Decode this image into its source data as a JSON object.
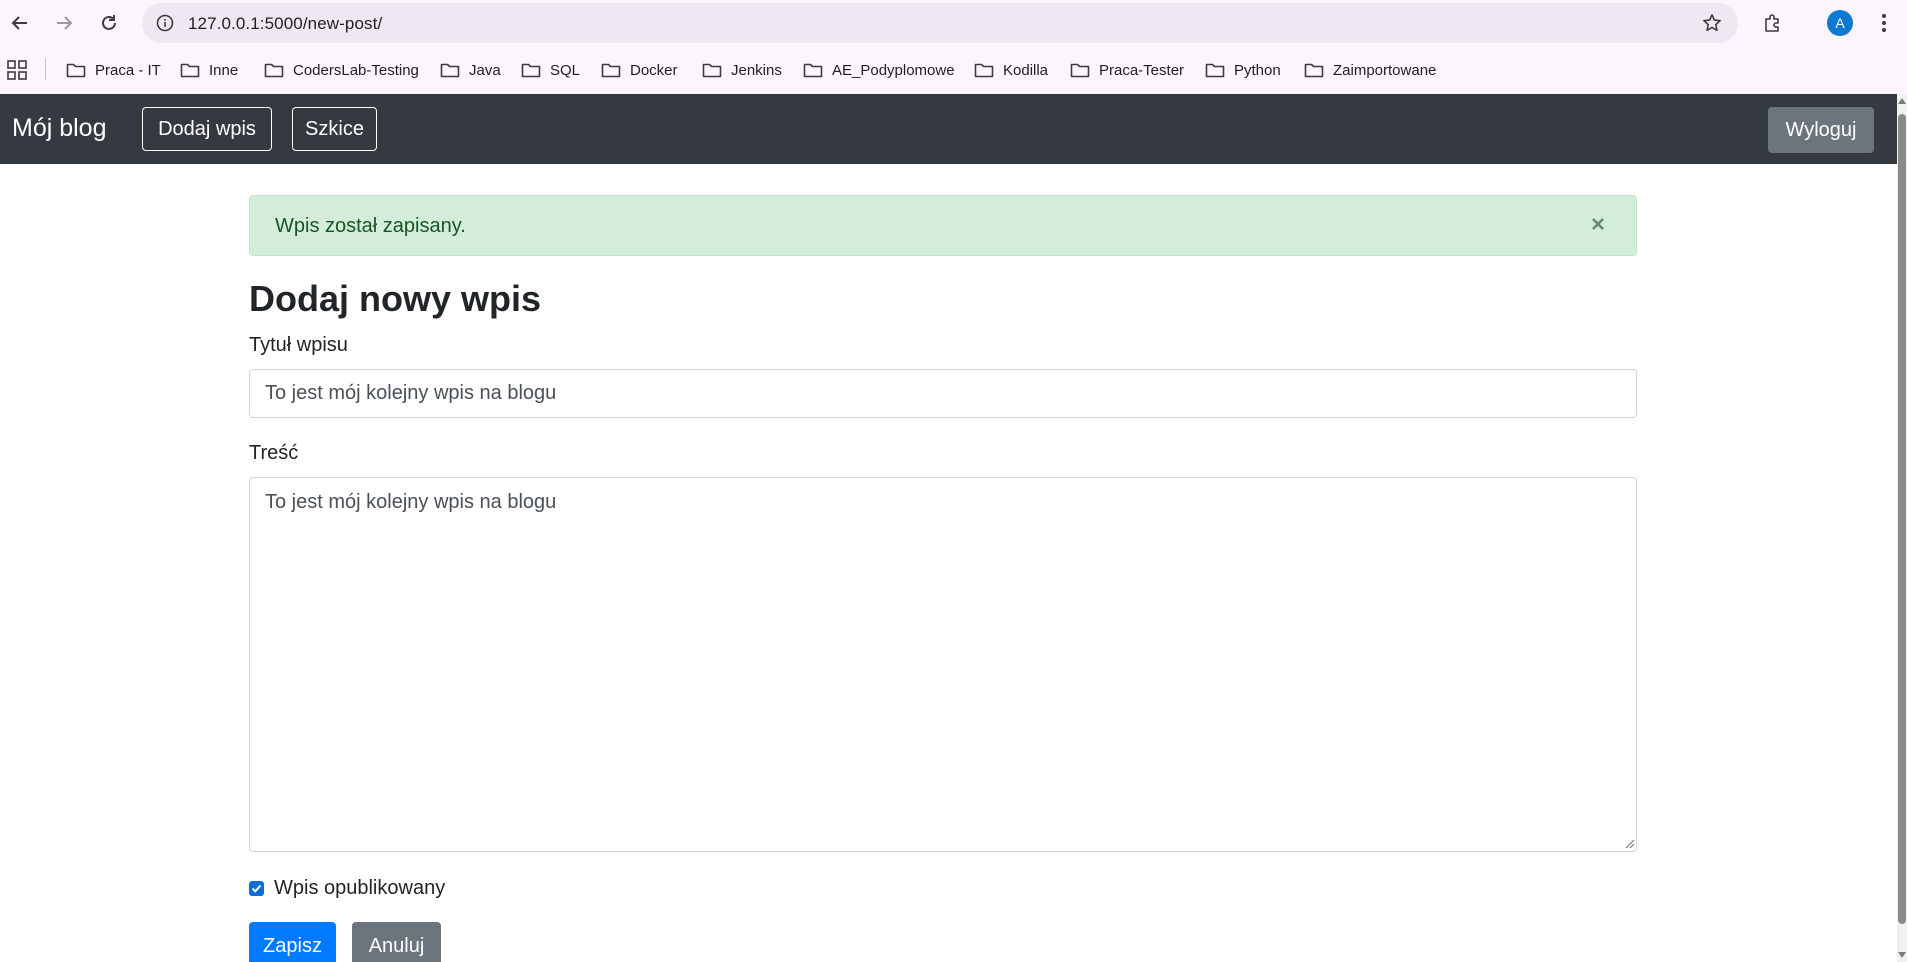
{
  "browser": {
    "url": "127.0.0.1:5000/new-post/",
    "profile_initial": "A",
    "bookmarks": [
      {
        "label": "Praca - IT"
      },
      {
        "label": "Inne"
      },
      {
        "label": "CodersLab-Testing"
      },
      {
        "label": "Java"
      },
      {
        "label": "SQL"
      },
      {
        "label": "Docker"
      },
      {
        "label": "Jenkins"
      },
      {
        "label": "AE_Podyplomowe"
      },
      {
        "label": "Kodilla"
      },
      {
        "label": "Praca-Tester"
      },
      {
        "label": "Python"
      },
      {
        "label": "Zaimportowane"
      }
    ]
  },
  "navbar": {
    "brand": "Mój blog",
    "add_post": "Dodaj wpis",
    "drafts": "Szkice",
    "logout": "Wyloguj"
  },
  "alert": {
    "message": "Wpis został zapisany.",
    "close": "×"
  },
  "form": {
    "heading": "Dodaj nowy wpis",
    "title_label": "Tytuł wpisu",
    "title_value": "To jest mój kolejny wpis na blogu",
    "content_label": "Treść",
    "content_value": "To jest mój kolejny wpis na blogu",
    "published_label": "Wpis opublikowany",
    "published_checked": true,
    "save_button": "Zapisz",
    "cancel_button": "Anuluj"
  },
  "colors": {
    "navbar_bg": "#343a40",
    "alert_bg": "#d4edda",
    "alert_text": "#155724",
    "primary": "#007bff",
    "secondary": "#6c757d"
  }
}
